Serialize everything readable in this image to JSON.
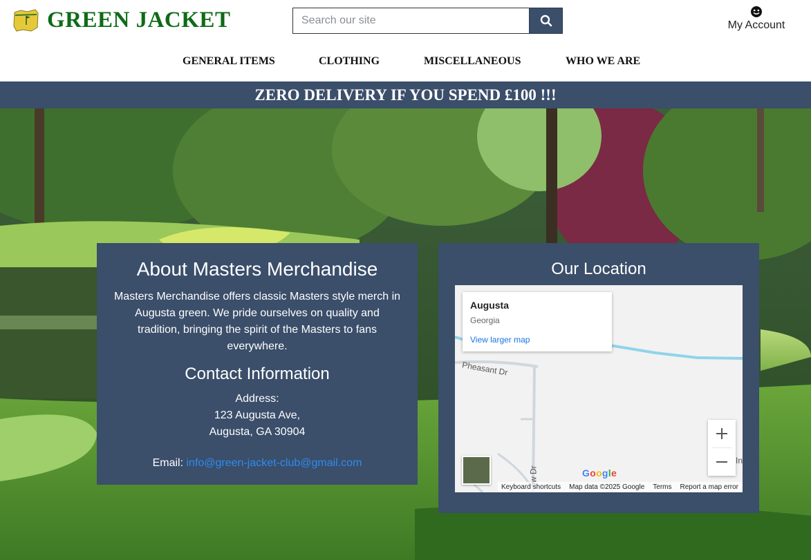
{
  "header": {
    "brand": "GREEN JACKET",
    "search_placeholder": "Search our site",
    "account_label": "My Account"
  },
  "nav": {
    "items": [
      "GENERAL ITEMS",
      "CLOTHING",
      "MISCELLANEOUS",
      "WHO WE ARE"
    ]
  },
  "promo": {
    "text": "ZERO DELIVERY IF YOU SPEND £100 !!!"
  },
  "about": {
    "title": "About Masters Merchandise",
    "body": "Masters Merchandise offers classic Masters style merch in Augusta green. We pride ourselves on quality and tradition, bringing the spirit of the Masters to fans everywhere.",
    "contact_title": "Contact Information",
    "address_label": "Address:",
    "address_line1": "123 Augusta Ave,",
    "address_line2": "Augusta, GA 30904",
    "email_label": "Email:",
    "email": "info@green-jacket-club@gmail.com"
  },
  "location": {
    "title": "Our Location",
    "map": {
      "place_name": "Augusta",
      "place_region": "Georgia",
      "larger_map_link": "View larger map",
      "road_label_1": "Pheasant Dr",
      "road_label_2": "ow Dr",
      "edge_label": "In",
      "google_logo": "Google",
      "footer": [
        "Keyboard shortcuts",
        "Map data ©2025 Google",
        "Terms",
        "Report a map error"
      ],
      "zoom_in": "+",
      "zoom_out": "−"
    }
  },
  "colors": {
    "brand_green": "#0e6b17",
    "navy": "#3b4e6a",
    "link_blue": "#2d8cf0"
  },
  "icons": {
    "logo": "masters-map-logo-icon",
    "search": "search-icon",
    "account": "smiley-user-icon"
  }
}
